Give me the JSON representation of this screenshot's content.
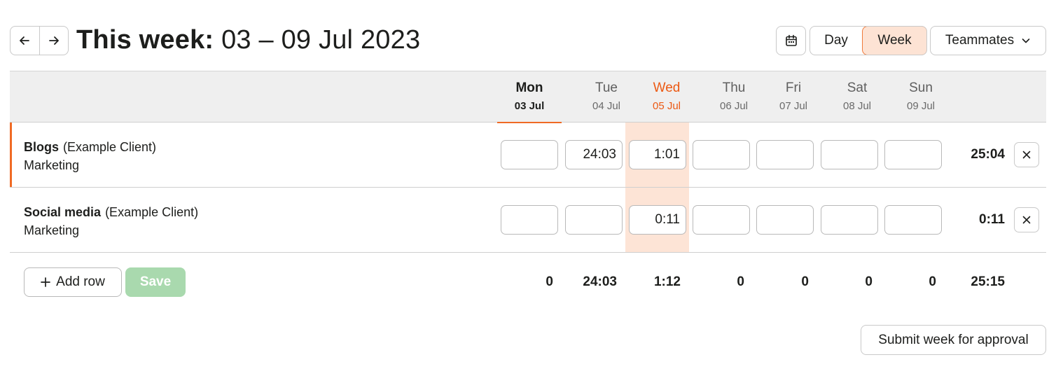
{
  "header": {
    "title_prefix": "This week:",
    "title_range": "03 – 09 Jul 2023",
    "view_day": "Day",
    "view_week": "Week",
    "teammates": "Teammates"
  },
  "days": [
    {
      "name": "Mon",
      "date": "03 Jul"
    },
    {
      "name": "Tue",
      "date": "04 Jul"
    },
    {
      "name": "Wed",
      "date": "05 Jul"
    },
    {
      "name": "Thu",
      "date": "06 Jul"
    },
    {
      "name": "Fri",
      "date": "07 Jul"
    },
    {
      "name": "Sat",
      "date": "08 Jul"
    },
    {
      "name": "Sun",
      "date": "09 Jul"
    }
  ],
  "rows": [
    {
      "project": "Blogs",
      "client": "(Example Client)",
      "task": "Marketing",
      "entries": [
        "",
        "24:03",
        "1:01",
        "",
        "",
        "",
        ""
      ],
      "total": "25:04"
    },
    {
      "project": "Social media",
      "client": "(Example Client)",
      "task": "Marketing",
      "entries": [
        "",
        "",
        "0:11",
        "",
        "",
        "",
        ""
      ],
      "total": "0:11"
    }
  ],
  "footer": {
    "add_row": "Add row",
    "save": "Save",
    "day_totals": [
      "0",
      "24:03",
      "1:12",
      "0",
      "0",
      "0",
      "0"
    ],
    "grand_total": "25:15",
    "submit": "Submit week for approval"
  },
  "colors": {
    "accent": "#f06a24",
    "selected_bg": "#fde3d4",
    "save_disabled": "#a9d9ae"
  }
}
